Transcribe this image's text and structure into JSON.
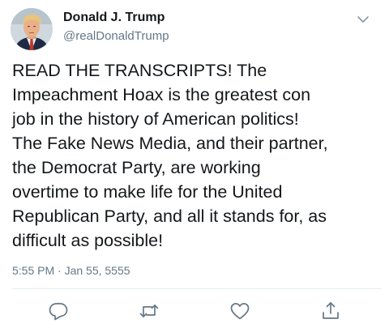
{
  "author": {
    "display_name": "Donald J. Trump",
    "handle": "@realDonaldTrump",
    "avatar_icon": "profile-photo"
  },
  "tweet": {
    "lines": [
      "READ THE TRANSCRIPTS! The",
      "Impeachment Hoax is the greatest con",
      "job in the history of American politics!",
      "The Fake News Media, and their partner,",
      "the Democrat Party, are working",
      "overtime to make life for the United",
      "Republican Party, and all it stands for, as",
      "difficult as possible!"
    ],
    "timestamp": "5:55 PM · Jan 55, 5555"
  },
  "actions": [
    {
      "name": "reply",
      "icon": "reply-icon"
    },
    {
      "name": "retweet",
      "icon": "retweet-icon"
    },
    {
      "name": "like",
      "icon": "heart-icon"
    },
    {
      "name": "share",
      "icon": "share-icon"
    }
  ],
  "colors": {
    "text": "#14171a",
    "secondary": "#657786",
    "divider": "#e6ecf0"
  }
}
